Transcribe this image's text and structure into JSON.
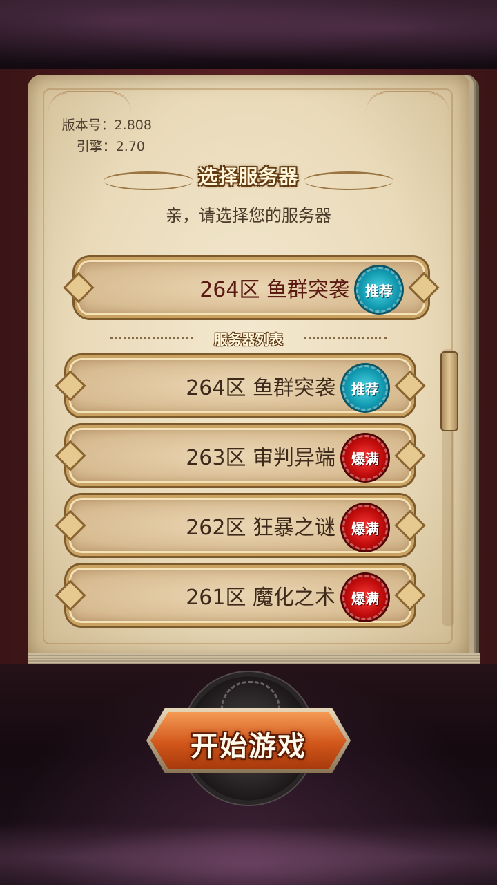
{
  "version": {
    "version_label": "版本号：2.808",
    "engine_label": "引擎：2.70"
  },
  "header": {
    "title": "选择服务器",
    "subtitle": "亲，请选择您的服务器"
  },
  "featured_server": {
    "label": "264区 鱼群突袭",
    "badge": "推荐"
  },
  "server_list": {
    "heading": "服务器列表",
    "items": [
      {
        "label": "264区 鱼群突袭",
        "badge": "推荐"
      },
      {
        "label": "263区 审判异端",
        "badge": "爆满"
      },
      {
        "label": "262区 狂暴之谜",
        "badge": "爆满"
      },
      {
        "label": "261区 魔化之术",
        "badge": "爆满"
      }
    ]
  },
  "start_button": {
    "label": "开始游戏"
  },
  "colors": {
    "recommended_badge": "#139bb2",
    "full_badge": "#c00c0c",
    "start_button": "#d2571b"
  }
}
